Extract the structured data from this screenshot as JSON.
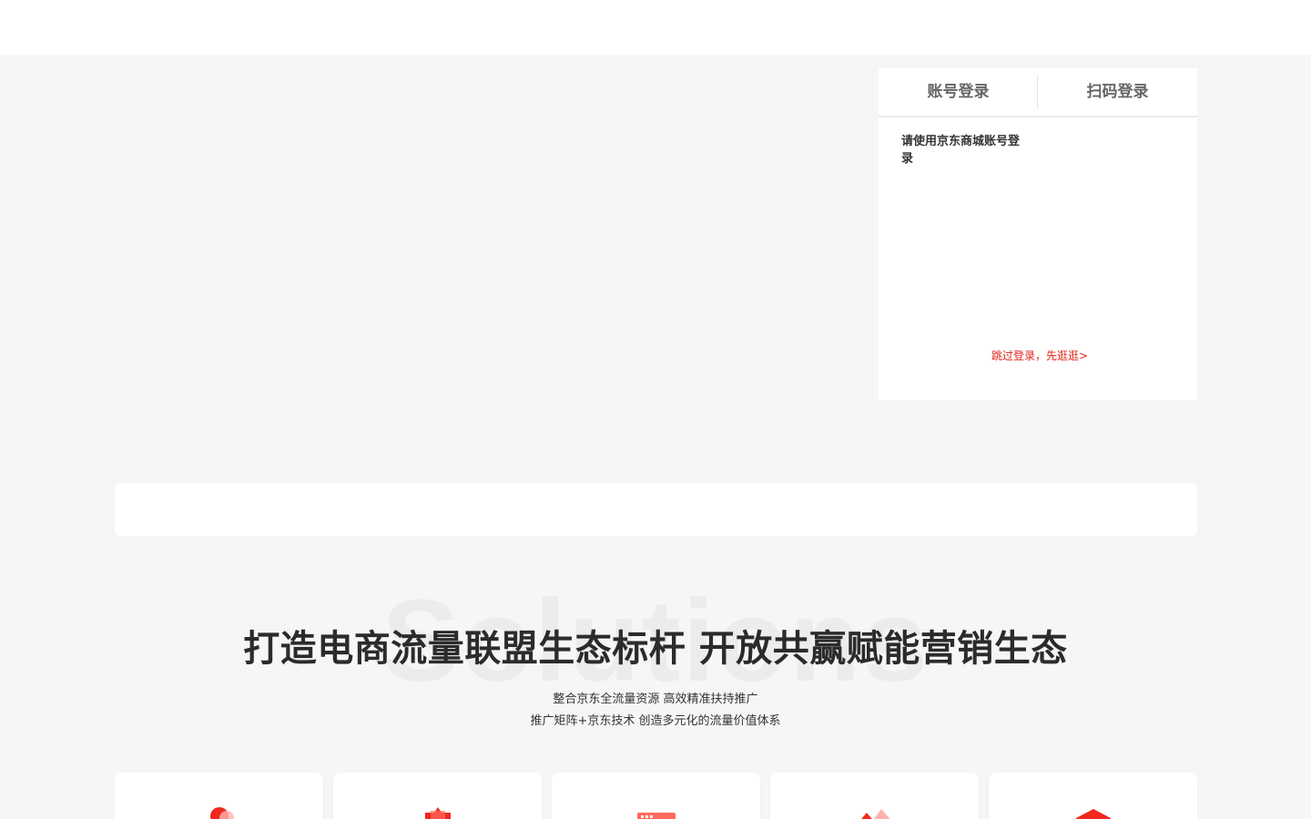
{
  "login": {
    "tabs": [
      "账号登录",
      "扫码登录"
    ],
    "hint": "请使用京东商城账号登录",
    "skip_link": "跳过登录，先逛逛>"
  },
  "solutions": {
    "bg_word": "Solutions",
    "headline": "打造电商流量联盟生态标杆 开放共赢赋能营销生态",
    "subline_1": "整合京东全流量资源 高效精准扶持推广",
    "subline_2": "推广矩阵+京东技术 创造多元化的流量价值体系"
  },
  "cards": [
    {
      "icon": "person-icon"
    },
    {
      "icon": "star-badge-icon"
    },
    {
      "icon": "calendar-icon"
    },
    {
      "icon": "chart-icon"
    },
    {
      "icon": "diamond-icon"
    }
  ],
  "colors": {
    "accent": "#e2231a",
    "background": "#f6f6f6"
  }
}
